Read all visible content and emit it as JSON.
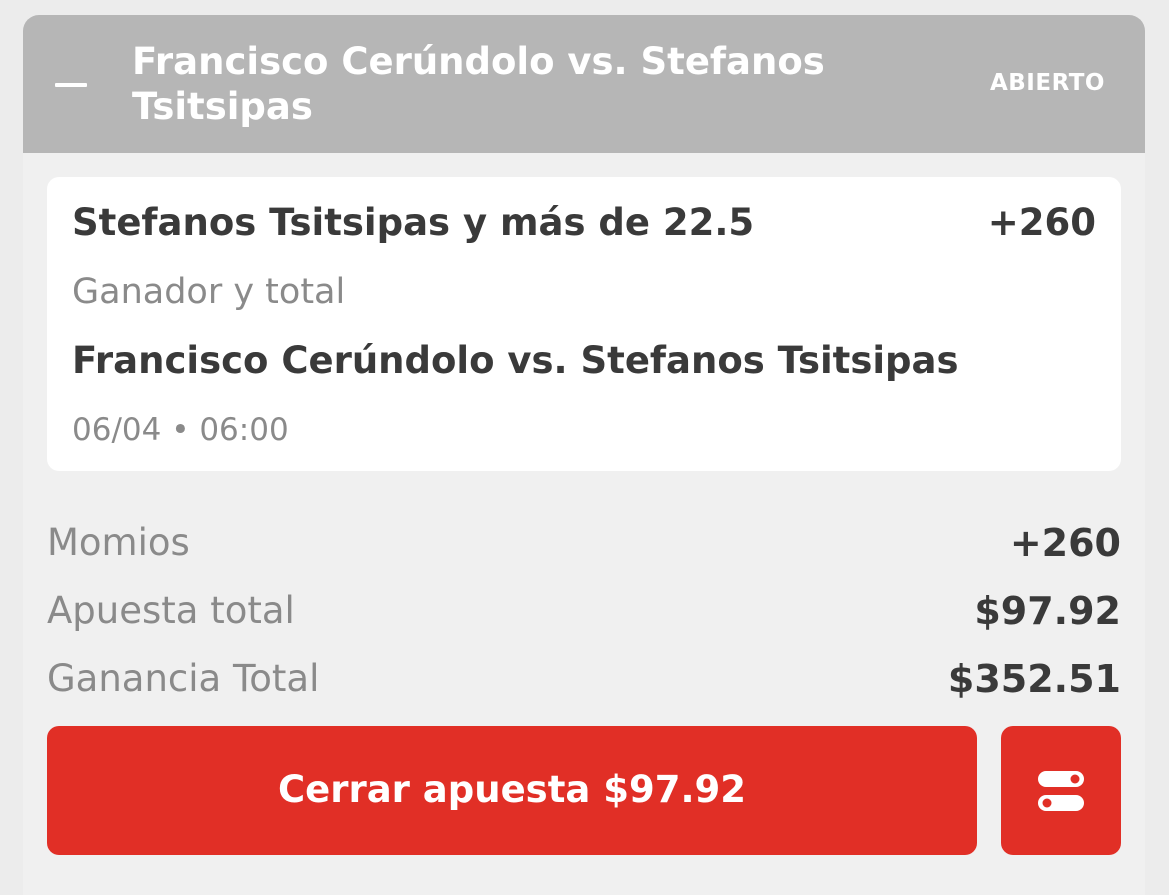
{
  "header": {
    "title": "Francisco Cerúndolo vs. Stefanos Tsitsipas",
    "status": "ABIERTO",
    "collapse_icon": "minus-icon"
  },
  "selection": {
    "name": "Stefanos Tsitsipas y más de 22.5",
    "odds": "+260",
    "market": "Ganador y total",
    "event": "Francisco Cerúndolo vs. Stefanos Tsitsipas",
    "datetime": "06/04 • 06:00"
  },
  "summary": {
    "odds_label": "Momios",
    "odds_value": "+260",
    "stake_label": "Apuesta total",
    "stake_value": "$97.92",
    "payout_label": "Ganancia Total",
    "payout_value": "$352.51"
  },
  "actions": {
    "cashout_label": "Cerrar apuesta $97.92",
    "settings_icon": "toggle-settings-icon"
  },
  "colors": {
    "header_bg": "#b6b6b6",
    "accent_red": "#e12f26",
    "card_bg": "#ffffff",
    "page_bg": "#f0f0f0"
  }
}
